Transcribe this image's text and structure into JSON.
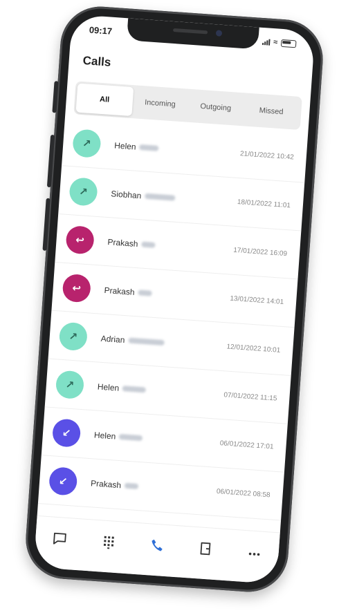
{
  "status_bar": {
    "time": "09:17"
  },
  "page": {
    "title": "Calls"
  },
  "tabs": [
    {
      "label": "All",
      "active": true
    },
    {
      "label": "Incoming",
      "active": false
    },
    {
      "label": "Outgoing",
      "active": false
    },
    {
      "label": "Missed",
      "active": false
    }
  ],
  "calls": [
    {
      "name": "Helen",
      "time": "21/01/2022 10:42",
      "type": "outgoing",
      "icon": "arrow-up-right-icon"
    },
    {
      "name": "Siobhan",
      "time": "18/01/2022 11:01",
      "type": "outgoing",
      "icon": "arrow-up-right-icon"
    },
    {
      "name": "Prakash",
      "time": "17/01/2022 16:09",
      "type": "missed",
      "icon": "missed-call-icon"
    },
    {
      "name": "Prakash",
      "time": "13/01/2022 14:01",
      "type": "missed",
      "icon": "missed-call-icon"
    },
    {
      "name": "Adrian",
      "time": "12/01/2022 10:01",
      "type": "outgoing",
      "icon": "arrow-up-right-icon"
    },
    {
      "name": "Helen",
      "time": "07/01/2022 11:15",
      "type": "outgoing",
      "icon": "arrow-up-right-icon"
    },
    {
      "name": "Helen",
      "time": "06/01/2022 17:01",
      "type": "incoming",
      "icon": "arrow-down-left-icon"
    },
    {
      "name": "Prakash",
      "time": "06/01/2022 08:58",
      "type": "incoming",
      "icon": "arrow-down-left-icon"
    }
  ],
  "bottom_nav": [
    {
      "icon": "chat-bubble-icon",
      "active": false
    },
    {
      "icon": "dialpad-icon",
      "active": false
    },
    {
      "icon": "phone-icon",
      "active": true
    },
    {
      "icon": "contacts-card-icon",
      "active": false
    },
    {
      "icon": "more-icon",
      "active": false
    }
  ],
  "colors": {
    "accent": "#2f6fd6",
    "outgoing": "#7fe0c6",
    "missed": "#b8236d",
    "incoming": "#5a50e6"
  }
}
